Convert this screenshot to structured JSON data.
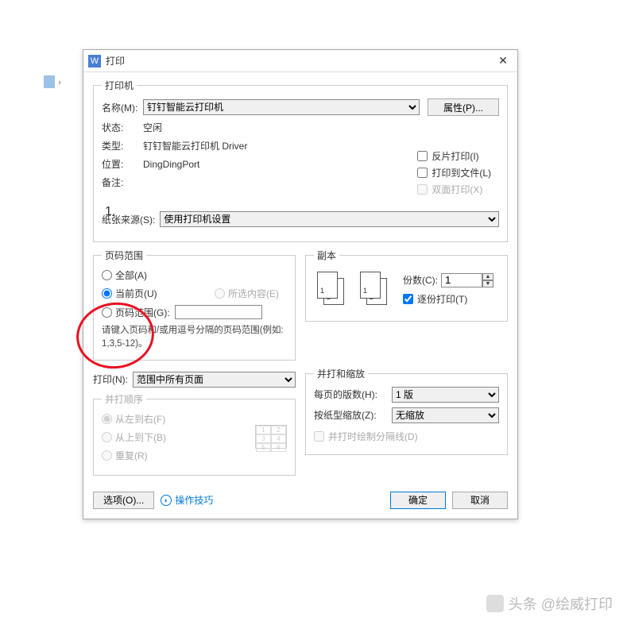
{
  "title": "打印",
  "app_icon": "W",
  "printer": {
    "legend": "打印机",
    "name_label": "名称(M):",
    "name_value": "钉钉智能云打印机",
    "properties_btn": "属性(P)...",
    "status_label": "状态:",
    "status_value": "空闲",
    "type_label": "类型:",
    "type_value": "钉钉智能云打印机 Driver",
    "where_label": "位置:",
    "where_value": "DingDingPort",
    "comment_label": "备注:",
    "reverse_label": "反片打印(I)",
    "tofile_label": "打印到文件(L)",
    "duplex_label": "双面打印(X)"
  },
  "step": "1.",
  "source_label": "纸张来源(S):",
  "source_value": "使用打印机设置",
  "range": {
    "legend": "页码范围",
    "all": "全部(A)",
    "current": "当前页(U)",
    "selection": "所选内容(E)",
    "pages": "页码范围(G):",
    "hint": "请键入页码和/或用逗号分隔的页码范围(例如: 1,3,5-12)。"
  },
  "copies": {
    "legend": "副本",
    "label": "份数(C):",
    "value": "1",
    "collate": "逐份打印(T)"
  },
  "print_what": {
    "label": "打印(N):",
    "value": "范围中所有页面"
  },
  "order": {
    "legend": "并打顺序",
    "lr": "从左到右(F)",
    "tb": "从上到下(B)",
    "repeat": "重复(R)"
  },
  "scale": {
    "legend": "并打和缩放",
    "pps_label": "每页的版数(H):",
    "pps_value": "1 版",
    "sz_label": "按纸型缩放(Z):",
    "sz_value": "无缩放",
    "divider": "并打时绘制分隔线(D)"
  },
  "footer": {
    "options": "选项(O)...",
    "tips": "操作技巧",
    "ok": "确定",
    "cancel": "取消"
  },
  "watermark": "头条 @绘威打印"
}
